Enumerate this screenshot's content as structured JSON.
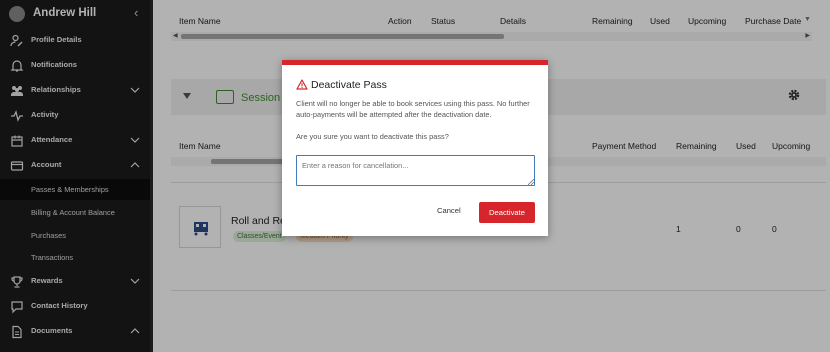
{
  "sidebar": {
    "user_name": "Andrew Hill",
    "items": [
      {
        "label": "Profile Details",
        "icon": "person-edit-icon"
      },
      {
        "label": "Notifications",
        "icon": "bell-icon"
      },
      {
        "label": "Relationships",
        "icon": "people-icon"
      },
      {
        "label": "Activity",
        "icon": "pulse-icon"
      },
      {
        "label": "Attendance",
        "icon": "calendar-icon"
      },
      {
        "label": "Account",
        "icon": "wallet-icon"
      },
      {
        "label": "Rewards",
        "icon": "trophy-icon"
      },
      {
        "label": "Contact History",
        "icon": "chat-icon"
      },
      {
        "label": "Documents",
        "icon": "document-icon"
      }
    ],
    "account_sub": [
      "Passes & Memberships",
      "Billing & Account Balance",
      "Purchases",
      "Transactions"
    ]
  },
  "top_table": {
    "headers": [
      "Item Name",
      "Action",
      "Status",
      "Details",
      "Remaining",
      "Used",
      "Upcoming",
      "Purchase Date"
    ]
  },
  "section": {
    "title": "Session Pass"
  },
  "lower_table": {
    "headers": [
      "Item Name",
      "Payment Method",
      "Remaining",
      "Used",
      "Upcoming"
    ],
    "row": {
      "title": "Roll and Rel",
      "badge_category": "Classes/Event",
      "badge_priority": "Medium Priority",
      "remaining": "1",
      "used": "0",
      "upcoming": "0"
    }
  },
  "modal": {
    "title": "Deactivate Pass",
    "body": "Client will no longer be able to book services using this pass. No further auto-payments will be attempted after the deactivation date.",
    "confirm": "Are you sure you want to deactivate this pass?",
    "reason_placeholder": "Enter a reason for cancellation...",
    "cancel_label": "Cancel",
    "deactivate_label": "Deactivate"
  },
  "colors": {
    "sidebar_bg": "#1c1c1c",
    "accent_red": "#d6262c",
    "section_green": "#3e8e2e"
  }
}
